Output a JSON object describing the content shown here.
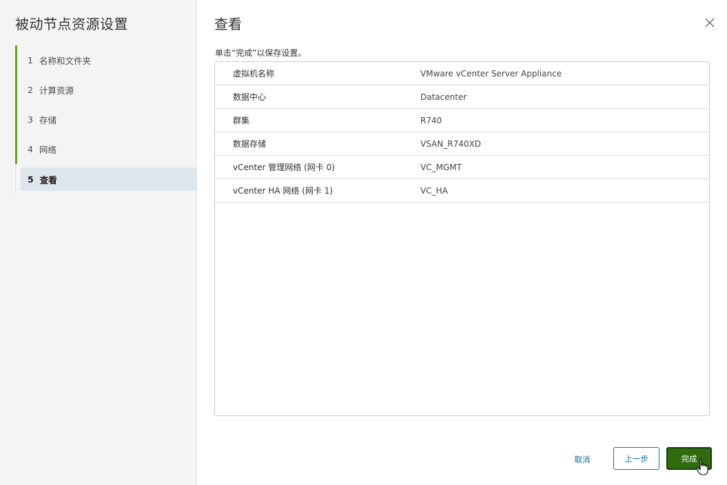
{
  "sidebar": {
    "title": "被动节点资源设置",
    "steps": [
      {
        "num": "1",
        "label": "名称和文件夹"
      },
      {
        "num": "2",
        "label": "计算资源"
      },
      {
        "num": "3",
        "label": "存储"
      },
      {
        "num": "4",
        "label": "网络"
      },
      {
        "num": "5",
        "label": "查看"
      }
    ]
  },
  "main": {
    "title": "查看",
    "instruction": "单击“完成”以保存设置。",
    "rows": [
      {
        "key": "虚拟机名称",
        "value": "VMware vCenter Server Appliance"
      },
      {
        "key": "数据中心",
        "value": "Datacenter"
      },
      {
        "key": "群集",
        "value": "R740"
      },
      {
        "key": "数据存储",
        "value": "VSAN_R740XD"
      },
      {
        "key": "vCenter 管理网络 (网卡 0)",
        "value": "VC_MGMT"
      },
      {
        "key": "vCenter HA 网络 (网卡 1)",
        "value": "VC_HA"
      }
    ]
  },
  "footer": {
    "cancel_label": "取消",
    "back_label": "上一步",
    "finish_label": "完成"
  },
  "colors": {
    "accent_green": "#62a420",
    "finish_button": "#2f6b0f",
    "link_blue": "#0079b8",
    "active_step_bg": "#dde6ed"
  },
  "icons": {
    "close": "close-icon",
    "cursor": "hand-cursor-icon"
  }
}
